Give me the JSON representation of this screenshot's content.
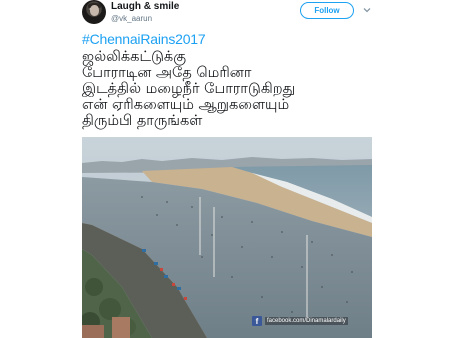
{
  "user": {
    "display_name": "Laugh & smile",
    "handle": "@vk_aarun",
    "follow_label": "Follow"
  },
  "tweet": {
    "hashtag": "#ChennaiRains2017",
    "lines": [
      "ஜல்லிக்கட்டுக்கு",
      "போராடின அதே மெரினா",
      "இடத்தில் மழைநீர் போராடுகிறது",
      "என் ஏரிகளையும் ஆறுகளையும்",
      "திரும்பி தாருங்கள்"
    ]
  },
  "photo": {
    "watermark": "facebook.com/Dinamalardaily",
    "watermark_icon": "facebook-icon"
  },
  "colors": {
    "accent": "#1da1f2",
    "text": "#14171a",
    "muted": "#657786"
  }
}
